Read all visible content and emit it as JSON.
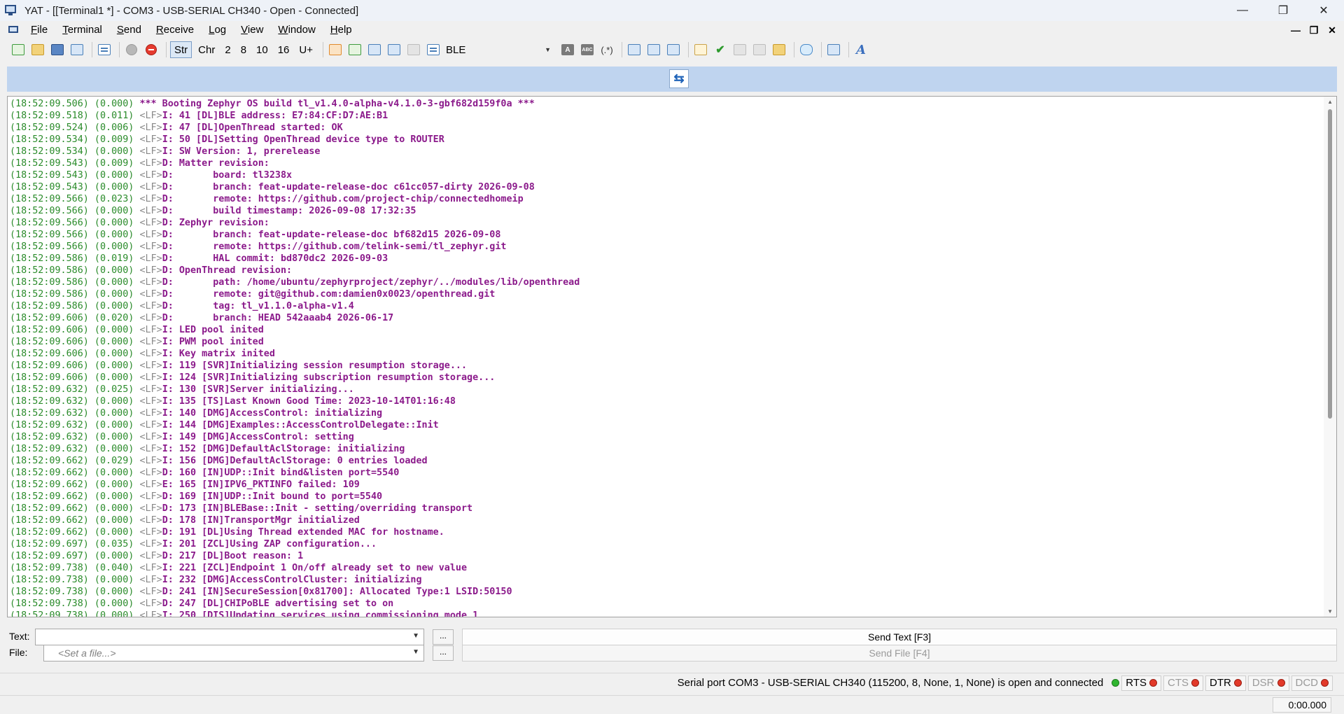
{
  "window": {
    "title": "YAT - [[Terminal1 *] - COM3 - USB-SERIAL CH340 - Open - Connected]",
    "minimize": "—",
    "maximize": "❐",
    "close": "✕"
  },
  "menu": {
    "items": [
      {
        "first": "F",
        "rest": "ile"
      },
      {
        "first": "T",
        "rest": "erminal"
      },
      {
        "first": "S",
        "rest": "end"
      },
      {
        "first": "R",
        "rest": "eceive"
      },
      {
        "first": "L",
        "rest": "og"
      },
      {
        "first": "V",
        "rest": "iew"
      },
      {
        "first": "W",
        "rest": "indow"
      },
      {
        "first": "H",
        "rest": "elp"
      }
    ],
    "mdi_minimize": "—",
    "mdi_restore": "❐",
    "mdi_close": "✕"
  },
  "toolbar": {
    "str": "Str",
    "chr": "Chr",
    "radix_2": "2",
    "radix_8": "8",
    "radix_10": "10",
    "radix_16": "16",
    "unicode": "U+",
    "preset": "BLE",
    "letter_a": "A",
    "abc": "ABC",
    "regex": "(.*)",
    "format_letter": "A",
    "check": "✔"
  },
  "banner": {
    "swap_glyph": "⇆"
  },
  "terminal": {
    "lines": [
      {
        "ts": "(18:52:09.506) (0.000) ",
        "ctl": "",
        "msg": "*** Booting Zephyr OS build tl_v1.4.0-alpha-v4.1.0-3-gbf682d159f0a ***"
      },
      {
        "ts": "(18:52:09.518) (0.011) ",
        "ctl": "<LF>",
        "msg": "I: 41 [DL]BLE address: E7:84:CF:D7:AE:B1"
      },
      {
        "ts": "(18:52:09.524) (0.006) ",
        "ctl": "<LF>",
        "msg": "I: 47 [DL]OpenThread started: OK"
      },
      {
        "ts": "(18:52:09.534) (0.009) ",
        "ctl": "<LF>",
        "msg": "I: 50 [DL]Setting OpenThread device type to ROUTER"
      },
      {
        "ts": "(18:52:09.534) (0.000) ",
        "ctl": "<LF>",
        "msg": "I: SW Version: 1, prerelease"
      },
      {
        "ts": "(18:52:09.543) (0.009) ",
        "ctl": "<LF>",
        "msg": "D: Matter revision:"
      },
      {
        "ts": "(18:52:09.543) (0.000) ",
        "ctl": "<LF>",
        "msg": "D:       board: tl3238x"
      },
      {
        "ts": "(18:52:09.543) (0.000) ",
        "ctl": "<LF>",
        "msg": "D:       branch: feat-update-release-doc c61cc057-dirty 2026-09-08"
      },
      {
        "ts": "(18:52:09.566) (0.023) ",
        "ctl": "<LF>",
        "msg": "D:       remote: https://github.com/project-chip/connectedhomeip"
      },
      {
        "ts": "(18:52:09.566) (0.000) ",
        "ctl": "<LF>",
        "msg": "D:       build timestamp: 2026-09-08 17:32:35"
      },
      {
        "ts": "(18:52:09.566) (0.000) ",
        "ctl": "<LF>",
        "msg": "D: Zephyr revision:"
      },
      {
        "ts": "(18:52:09.566) (0.000) ",
        "ctl": "<LF>",
        "msg": "D:       branch: feat-update-release-doc bf682d15 2026-09-08"
      },
      {
        "ts": "(18:52:09.566) (0.000) ",
        "ctl": "<LF>",
        "msg": "D:       remote: https://github.com/telink-semi/tl_zephyr.git"
      },
      {
        "ts": "(18:52:09.586) (0.019) ",
        "ctl": "<LF>",
        "msg": "D:       HAL commit: bd870dc2 2026-09-03"
      },
      {
        "ts": "(18:52:09.586) (0.000) ",
        "ctl": "<LF>",
        "msg": "D: OpenThread revision:"
      },
      {
        "ts": "(18:52:09.586) (0.000) ",
        "ctl": "<LF>",
        "msg": "D:       path: /home/ubuntu/zephyrproject/zephyr/../modules/lib/openthread"
      },
      {
        "ts": "(18:52:09.586) (0.000) ",
        "ctl": "<LF>",
        "msg": "D:       remote: git@github.com:damien0x0023/openthread.git"
      },
      {
        "ts": "(18:52:09.586) (0.000) ",
        "ctl": "<LF>",
        "msg": "D:       tag: tl_v1.1.0-alpha-v1.4"
      },
      {
        "ts": "(18:52:09.606) (0.020) ",
        "ctl": "<LF>",
        "msg": "D:       branch: HEAD 542aaab4 2026-06-17"
      },
      {
        "ts": "(18:52:09.606) (0.000) ",
        "ctl": "<LF>",
        "msg": "I: LED pool inited"
      },
      {
        "ts": "(18:52:09.606) (0.000) ",
        "ctl": "<LF>",
        "msg": "I: PWM pool inited"
      },
      {
        "ts": "(18:52:09.606) (0.000) ",
        "ctl": "<LF>",
        "msg": "I: Key matrix inited"
      },
      {
        "ts": "(18:52:09.606) (0.000) ",
        "ctl": "<LF>",
        "msg": "I: 119 [SVR]Initializing session resumption storage..."
      },
      {
        "ts": "(18:52:09.606) (0.000) ",
        "ctl": "<LF>",
        "msg": "I: 124 [SVR]Initializing subscription resumption storage..."
      },
      {
        "ts": "(18:52:09.632) (0.025) ",
        "ctl": "<LF>",
        "msg": "I: 130 [SVR]Server initializing..."
      },
      {
        "ts": "(18:52:09.632) (0.000) ",
        "ctl": "<LF>",
        "msg": "I: 135 [TS]Last Known Good Time: 2023-10-14T01:16:48"
      },
      {
        "ts": "(18:52:09.632) (0.000) ",
        "ctl": "<LF>",
        "msg": "I: 140 [DMG]AccessControl: initializing"
      },
      {
        "ts": "(18:52:09.632) (0.000) ",
        "ctl": "<LF>",
        "msg": "I: 144 [DMG]Examples::AccessControlDelegate::Init"
      },
      {
        "ts": "(18:52:09.632) (0.000) ",
        "ctl": "<LF>",
        "msg": "I: 149 [DMG]AccessControl: setting"
      },
      {
        "ts": "(18:52:09.632) (0.000) ",
        "ctl": "<LF>",
        "msg": "I: 152 [DMG]DefaultAclStorage: initializing"
      },
      {
        "ts": "(18:52:09.662) (0.029) ",
        "ctl": "<LF>",
        "msg": "I: 156 [DMG]DefaultAclStorage: 0 entries loaded"
      },
      {
        "ts": "(18:52:09.662) (0.000) ",
        "ctl": "<LF>",
        "msg": "D: 160 [IN]UDP::Init bind&listen port=5540"
      },
      {
        "ts": "(18:52:09.662) (0.000) ",
        "ctl": "<LF>",
        "msg": "E: 165 [IN]IPV6_PKTINFO failed: 109"
      },
      {
        "ts": "(18:52:09.662) (0.000) ",
        "ctl": "<LF>",
        "msg": "D: 169 [IN]UDP::Init bound to port=5540"
      },
      {
        "ts": "(18:52:09.662) (0.000) ",
        "ctl": "<LF>",
        "msg": "D: 173 [IN]BLEBase::Init - setting/overriding transport"
      },
      {
        "ts": "(18:52:09.662) (0.000) ",
        "ctl": "<LF>",
        "msg": "D: 178 [IN]TransportMgr initialized"
      },
      {
        "ts": "(18:52:09.662) (0.000) ",
        "ctl": "<LF>",
        "msg": "D: 191 [DL]Using Thread extended MAC for hostname."
      },
      {
        "ts": "(18:52:09.697) (0.035) ",
        "ctl": "<LF>",
        "msg": "I: 201 [ZCL]Using ZAP configuration..."
      },
      {
        "ts": "(18:52:09.697) (0.000) ",
        "ctl": "<LF>",
        "msg": "D: 217 [DL]Boot reason: 1"
      },
      {
        "ts": "(18:52:09.738) (0.040) ",
        "ctl": "<LF>",
        "msg": "I: 221 [ZCL]Endpoint 1 On/off already set to new value"
      },
      {
        "ts": "(18:52:09.738) (0.000) ",
        "ctl": "<LF>",
        "msg": "I: 232 [DMG]AccessControlCluster: initializing"
      },
      {
        "ts": "(18:52:09.738) (0.000) ",
        "ctl": "<LF>",
        "msg": "D: 241 [IN]SecureSession[0x81700]: Allocated Type:1 LSID:50150"
      },
      {
        "ts": "(18:52:09.738) (0.000) ",
        "ctl": "<LF>",
        "msg": "D: 247 [DL]CHIPoBLE advertising set to on"
      },
      {
        "ts": "(18:52:09.738) (0.000) ",
        "ctl": "<LF>",
        "msg": "I: 250 [DIS]Updating services using commissioning mode 1"
      }
    ]
  },
  "send": {
    "text_label": "Text:",
    "text_value": "",
    "file_label": "File:",
    "file_placeholder": "<Set a file...>",
    "ellipsis": "...",
    "send_text_button": "Send Text [F3]",
    "send_file_button": "Send File [F4]"
  },
  "status": {
    "message": "Serial port COM3 - USB-SERIAL CH340 (115200, 8, None, 1, None) is open and connected",
    "signals": [
      {
        "name": "RTS",
        "state": "active"
      },
      {
        "name": "CTS",
        "state": "inactive"
      },
      {
        "name": "DTR",
        "state": "active"
      },
      {
        "name": "DSR",
        "state": "inactive"
      },
      {
        "name": "DCD",
        "state": "inactive"
      }
    ],
    "timer": "0:00.000"
  },
  "colors": {
    "timestamp": "#2a8b2a",
    "control": "#8a8a8a",
    "message": "#8b1a8b",
    "banner": "#bfd4ef"
  }
}
